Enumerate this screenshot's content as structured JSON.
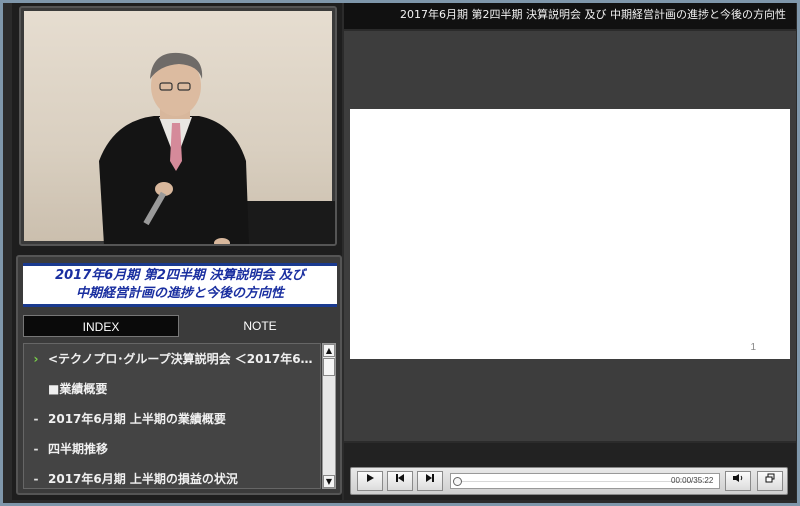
{
  "header": {
    "title": "2017年6月期 第2四半期 決算説明会 及び 中期経営計画の進捗と今後の方向性"
  },
  "title_card": {
    "line1": "2017年6月期  第2四半期  決算説明会  及び",
    "line2": "中期経営計画の進捗と今後の方向性"
  },
  "tabs": {
    "index": "INDEX",
    "note": "NOTE"
  },
  "index_items": [
    {
      "marker": "›",
      "label": "<テクノプロ･グループ決算説明会 ＜2017年6…"
    },
    {
      "marker": "",
      "label": "■業績概要"
    },
    {
      "marker": "-",
      "label": "2017年6月期 上半期の業績概要"
    },
    {
      "marker": "-",
      "label": "四半期推移"
    },
    {
      "marker": "-",
      "label": "2017年6月期 上半期の損益の状況"
    }
  ],
  "slide": {
    "page_number": "1"
  },
  "player": {
    "time": "00:00/35:22",
    "play_icon": "play-icon",
    "prev_icon": "skip-back-icon",
    "next_icon": "skip-forward-icon",
    "volume_icon": "volume-icon",
    "window_icon": "window-toggle-icon"
  },
  "colors": {
    "accent_blue": "#1a3a8f",
    "title_text": "#1a2fa0",
    "chevron_green": "#7ad14a",
    "frame_border": "#7f97ab"
  }
}
